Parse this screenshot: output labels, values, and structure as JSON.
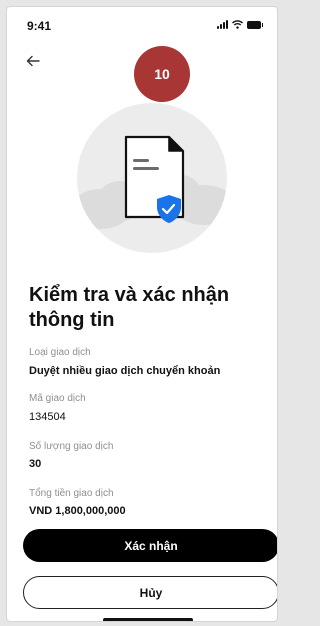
{
  "status_bar": {
    "time": "9:41",
    "icons": [
      "signal-icon",
      "wifi-icon",
      "battery-icon"
    ]
  },
  "header": {
    "back_icon": "arrow-left-icon",
    "step_badge": "10"
  },
  "illustration": {
    "icon": "document-shield-check-icon",
    "accent_color": "#1a73e8"
  },
  "title": "Kiểm tra và xác nhận thông tin",
  "fields": [
    {
      "label": "Loại giao dịch",
      "value": "Duyệt nhiều giao dịch chuyển khoản"
    },
    {
      "label": "Mã giao dịch",
      "value": "134504"
    },
    {
      "label": "Số lượng giao dịch",
      "value": "30"
    },
    {
      "label": "Tổng tiền giao dịch",
      "value": "VND 1,800,000,000"
    }
  ],
  "buttons": {
    "confirm": "Xác nhận",
    "cancel": "Hủy"
  },
  "colors": {
    "badge": "#a83634",
    "primary_button": "#000000",
    "label_text": "#8f8f8f"
  }
}
